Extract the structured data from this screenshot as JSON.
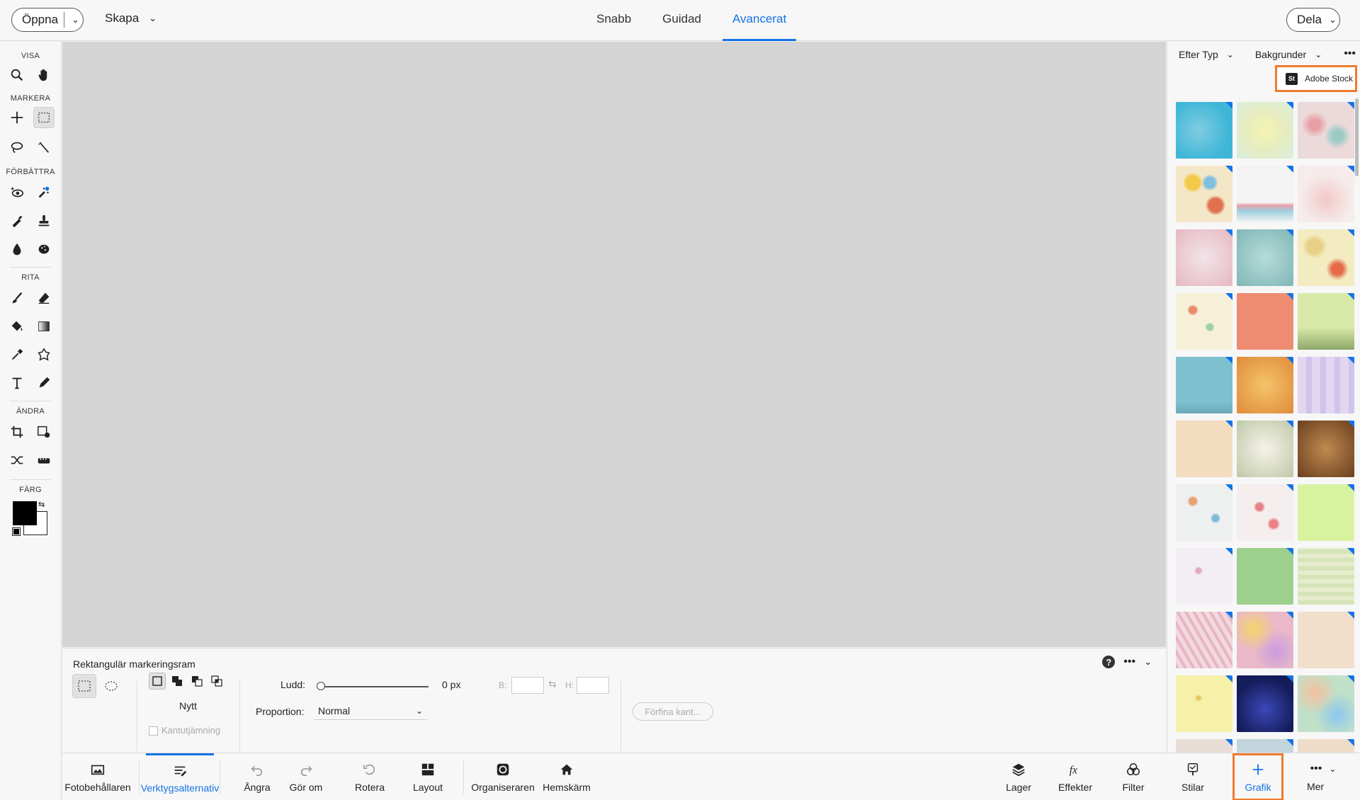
{
  "topbar": {
    "open_label": "Öppna",
    "create_label": "Skapa",
    "share_label": "Dela",
    "modes": [
      {
        "label": "Snabb",
        "active": false
      },
      {
        "label": "Guidad",
        "active": false
      },
      {
        "label": "Avancerat",
        "active": true
      }
    ]
  },
  "toolbar": {
    "sections": {
      "view": "VISA",
      "select": "MARKERA",
      "enhance": "FÖRBÄTTRA",
      "draw": "RITA",
      "modify": "ÄNDRA",
      "color": "FÄRG"
    }
  },
  "options": {
    "title": "Rektangulär markeringsram",
    "mode_label": "Nytt",
    "antialias_label": "Kantutjämning",
    "feather_label": "Ludd:",
    "feather_value": "0 px",
    "width_label": "B:",
    "height_label": "H:",
    "aspect_label": "Proportion:",
    "aspect_value": "Normal",
    "refine_label": "Förfina kant..."
  },
  "right_panel": {
    "filter_type": "Efter Typ",
    "category": "Bakgrunder",
    "stock_label": "Adobe Stock",
    "stock_logo_text": "St",
    "thumbnail_count": 33
  },
  "bottombar": {
    "photo_bin": "Fotobehållaren",
    "tool_options": "Verktygsalternativ",
    "undo": "Ångra",
    "redo": "Gör om",
    "rotate": "Rotera",
    "layout": "Layout",
    "organizer": "Organiseraren",
    "home": "Hemskärm",
    "layers": "Lager",
    "effects": "Effekter",
    "filters": "Filter",
    "styles": "Stilar",
    "graphics": "Grafik",
    "more": "Mer"
  },
  "colors": {
    "accent": "#1473e6",
    "highlight": "#ef7b2e",
    "canvas": "#d4d4d4",
    "foreground": "#000000",
    "background": "#ffffff"
  }
}
